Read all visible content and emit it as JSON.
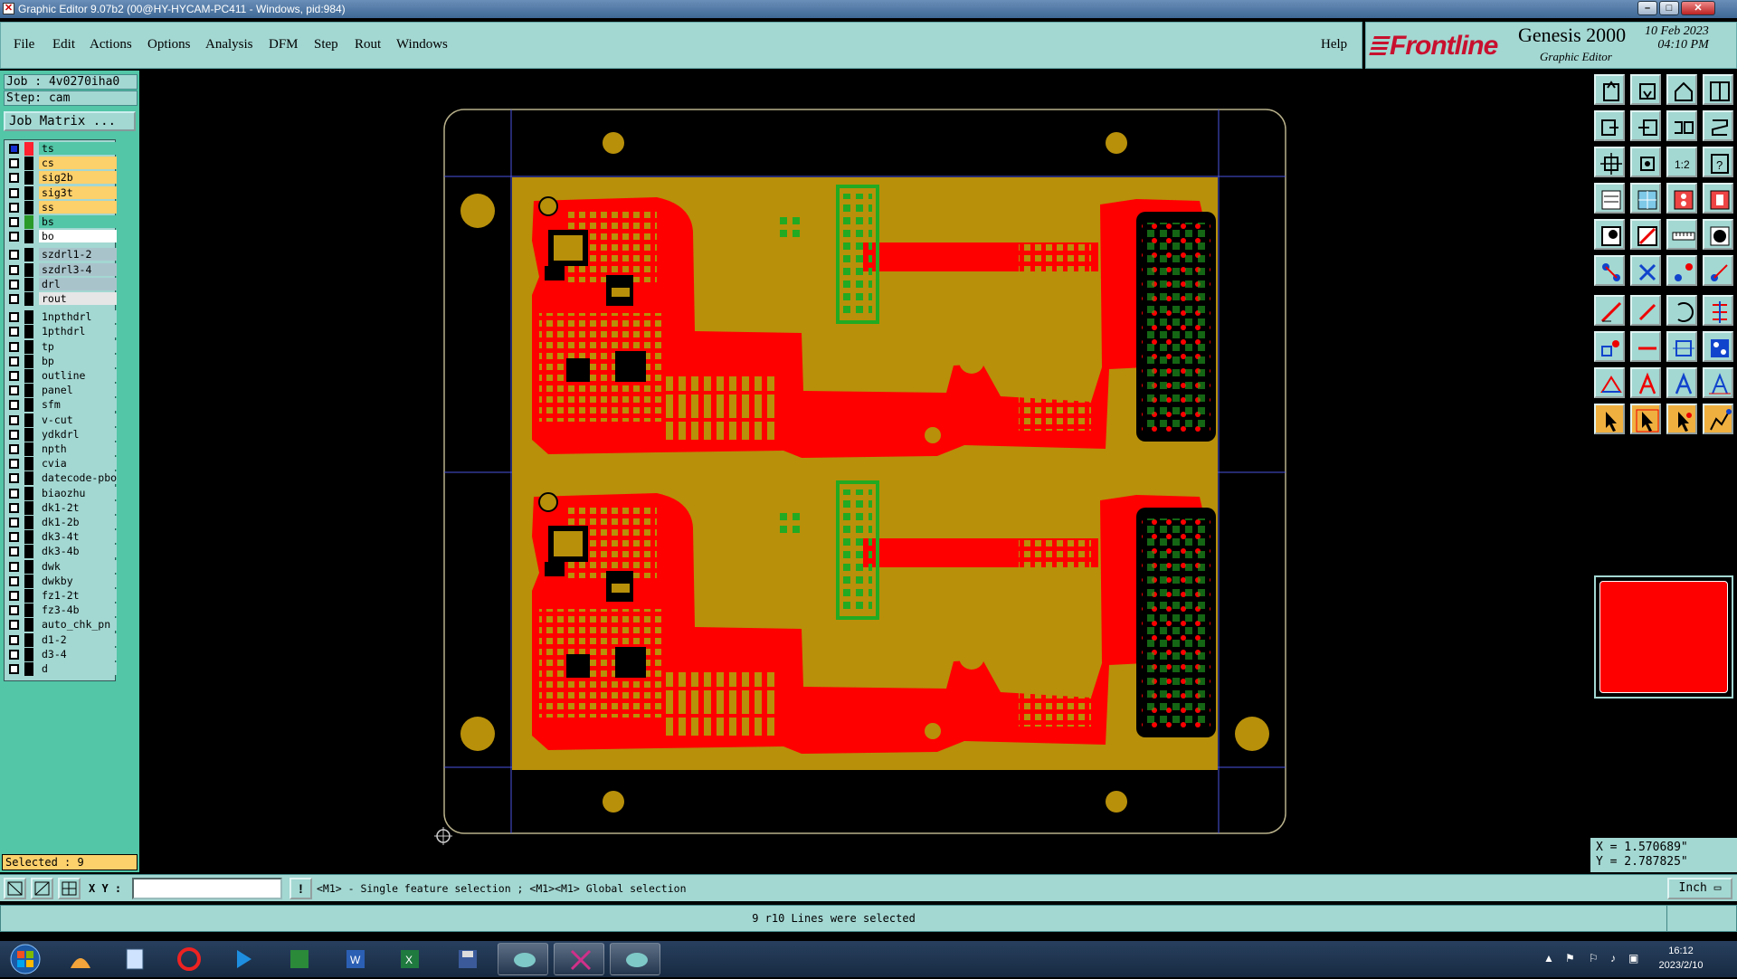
{
  "window": {
    "title": "Graphic Editor 9.07b2 (00@HY-HYCAM-PC411 - Windows, pid:984)",
    "min_label": "–",
    "max_label": "□",
    "close_label": "✕"
  },
  "menu": {
    "items": [
      "File",
      "Edit",
      "Actions",
      "Options",
      "Analysis",
      "DFM",
      "Step",
      "Rout",
      "Windows"
    ],
    "help": "Help"
  },
  "brand": {
    "logo_text": "Frontline",
    "product": "Genesis 2000",
    "subtitle": "Graphic Editor",
    "date": "10 Feb 2023",
    "time": "04:10 PM"
  },
  "left": {
    "job": "Job : 4v0270iha0",
    "step": "Step: cam",
    "job_matrix_label": "Job Matrix ...",
    "selected": "Selected : 9",
    "layers": [
      {
        "name": "ts",
        "bg": "#52c6a7",
        "mark": "red-arrow"
      },
      {
        "name": "cs",
        "bg": "#fcd06b",
        "mark": "pencil"
      },
      {
        "name": "sig2b",
        "bg": "#fcd06b"
      },
      {
        "name": "sig3t",
        "bg": "#fcd06b"
      },
      {
        "name": "ss",
        "bg": "#fcd06b"
      },
      {
        "name": "bs",
        "bg": "#52c6a7",
        "mark": "green"
      },
      {
        "name": "bo",
        "bg": "#ffffff"
      },
      {
        "name": "szdrl1-2",
        "bg": "#a9c3cb",
        "gap": true
      },
      {
        "name": "szdrl3-4",
        "bg": "#a9c3cb"
      },
      {
        "name": "drl",
        "bg": "#a9c3cb"
      },
      {
        "name": "rout",
        "bg": "#e6e6e6"
      },
      {
        "name": "1npthdrl",
        "bg": "#a3d7d2",
        "gap": true
      },
      {
        "name": "1pthdrl",
        "bg": "#a3d7d2"
      },
      {
        "name": "tp",
        "bg": "#a3d7d2"
      },
      {
        "name": "bp",
        "bg": "#a3d7d2"
      },
      {
        "name": "outline",
        "bg": "#a3d7d2"
      },
      {
        "name": "panel",
        "bg": "#a3d7d2"
      },
      {
        "name": "sfm",
        "bg": "#a3d7d2"
      },
      {
        "name": "v-cut",
        "bg": "#a3d7d2"
      },
      {
        "name": "ydkdrl",
        "bg": "#a3d7d2"
      },
      {
        "name": "npth",
        "bg": "#a3d7d2"
      },
      {
        "name": "cvia",
        "bg": "#a3d7d2"
      },
      {
        "name": "datecode-pbo",
        "bg": "#a3d7d2"
      },
      {
        "name": "biaozhu",
        "bg": "#a3d7d2"
      },
      {
        "name": "dk1-2t",
        "bg": "#a3d7d2"
      },
      {
        "name": "dk1-2b",
        "bg": "#a3d7d2"
      },
      {
        "name": "dk3-4t",
        "bg": "#a3d7d2"
      },
      {
        "name": "dk3-4b",
        "bg": "#a3d7d2"
      },
      {
        "name": "dwk",
        "bg": "#a3d7d2"
      },
      {
        "name": "dwkby",
        "bg": "#a3d7d2"
      },
      {
        "name": "fz1-2t",
        "bg": "#a3d7d2"
      },
      {
        "name": "fz3-4b",
        "bg": "#a3d7d2"
      },
      {
        "name": "auto_chk_pn",
        "bg": "#a3d7d2"
      },
      {
        "name": "d1-2",
        "bg": "#a3d7d2"
      },
      {
        "name": "d3-4",
        "bg": "#a3d7d2"
      },
      {
        "name": "d",
        "bg": "#a3d7d2"
      }
    ]
  },
  "toolbar_icons": [
    "open-job-icon",
    "save-icon",
    "home-icon",
    "layout-icon",
    "step-in-icon",
    "step-out-icon",
    "split-icon",
    "mirror-icon",
    "zoom-fit-icon",
    "zoom-extent-icon",
    "scale-1-2-icon",
    "help-icon",
    "measure-icon",
    "grid-icon",
    "layer-red-icon",
    "layer-blue-icon",
    "pad-add-icon",
    "surface-add-icon",
    "ruler-icon",
    "circle-icon",
    "move-icon",
    "delete-icon",
    "copy-icon",
    "connect-icon",
    "line-icon",
    "line-2-icon",
    "arc-icon",
    "rotate-icon",
    "pad-icon",
    "dash-icon",
    "inline-icon",
    "array-icon",
    "triangle-icon",
    "text-icon",
    "text-2-icon",
    "text-3-icon",
    "pointer-icon",
    "select-icon",
    "select-2-icon",
    "snap-icon"
  ],
  "coords": {
    "x": "X = 1.570689\"",
    "y": "Y = 2.787825\""
  },
  "bottom": {
    "xy_label": "X Y :",
    "xy_value": "",
    "hint": "<M1> - Single feature selection ; <M1><M1> Global selection",
    "unit": "Inch",
    "status": "9 r10 Lines were selected"
  },
  "taskbar": {
    "time": "16:12",
    "date": "2023/2/10"
  },
  "colors": {
    "panel": "#a3d7d2",
    "board": "#b8900a",
    "copper": "#ff0000",
    "green_layer": "#22aa22",
    "cyan_bg": "#52c6a7"
  }
}
